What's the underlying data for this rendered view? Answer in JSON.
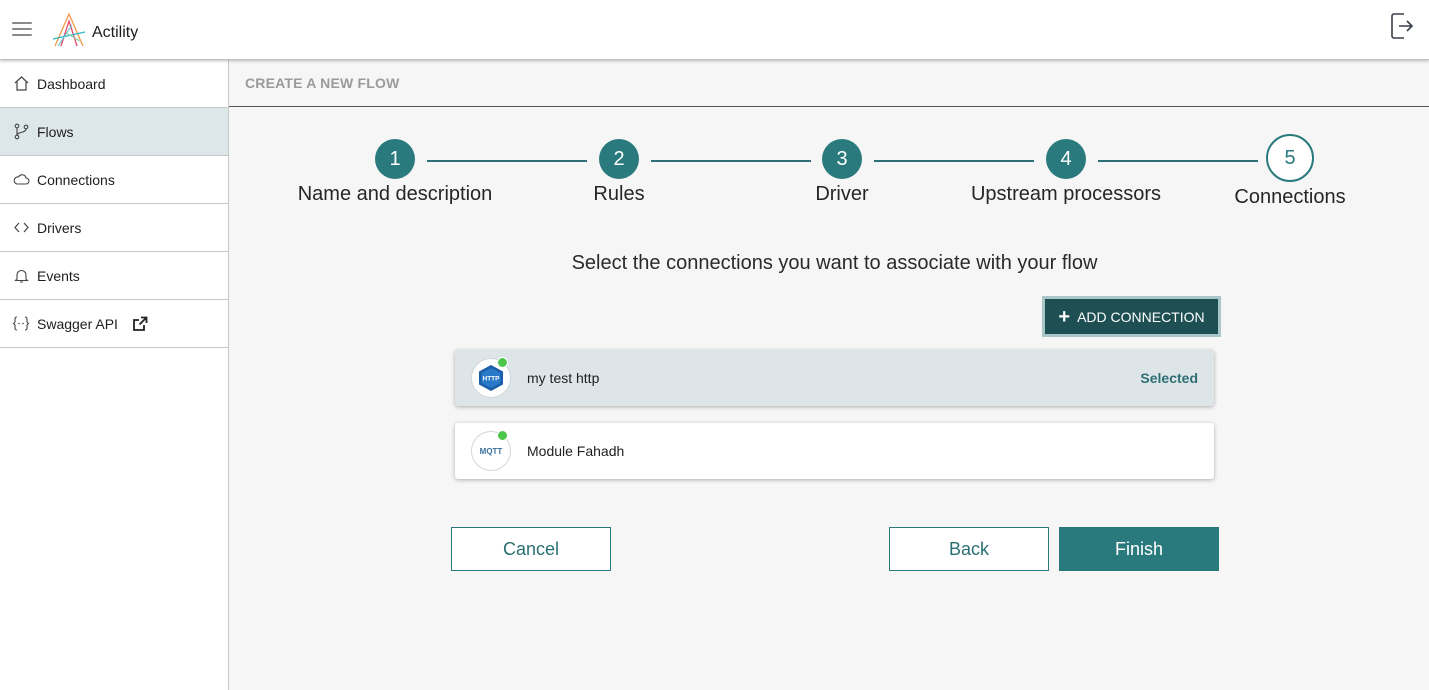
{
  "app": {
    "name": "Actility"
  },
  "header": {
    "menu_icon": "hamburger-menu-icon",
    "logout_icon": "logout-icon"
  },
  "sidebar": {
    "items": [
      {
        "label": "Dashboard",
        "icon": "home-icon",
        "active": false
      },
      {
        "label": "Flows",
        "icon": "flow-branch-icon",
        "active": true
      },
      {
        "label": "Connections",
        "icon": "cloud-icon",
        "active": false
      },
      {
        "label": "Drivers",
        "icon": "code-icon",
        "active": false
      },
      {
        "label": "Events",
        "icon": "bell-icon",
        "active": false
      },
      {
        "label": "Swagger API",
        "icon": "braces-icon",
        "active": false,
        "external": true
      }
    ]
  },
  "page": {
    "title": "CREATE A NEW FLOW"
  },
  "stepper": {
    "steps": [
      {
        "number": "1",
        "label": "Name and description",
        "state": "done"
      },
      {
        "number": "2",
        "label": "Rules",
        "state": "done"
      },
      {
        "number": "3",
        "label": "Driver",
        "state": "done"
      },
      {
        "number": "4",
        "label": "Upstream processors",
        "state": "done"
      },
      {
        "number": "5",
        "label": "Connections",
        "state": "current"
      }
    ]
  },
  "connections": {
    "instruction": "Select the connections you want to associate with your flow",
    "add_button": "ADD CONNECTION",
    "items": [
      {
        "name": "my test http",
        "protocol": "HTTP",
        "status": "online",
        "selected": true,
        "selected_label": "Selected"
      },
      {
        "name": "Module Fahadh",
        "protocol": "MQTT",
        "status": "online",
        "selected": false
      }
    ]
  },
  "actions": {
    "cancel": "Cancel",
    "back": "Back",
    "finish": "Finish"
  },
  "colors": {
    "accent": "#2a7a7d",
    "accent_dark": "#1e4f53",
    "selected_bg": "#dde5e8",
    "status_online": "#4cc74c"
  }
}
